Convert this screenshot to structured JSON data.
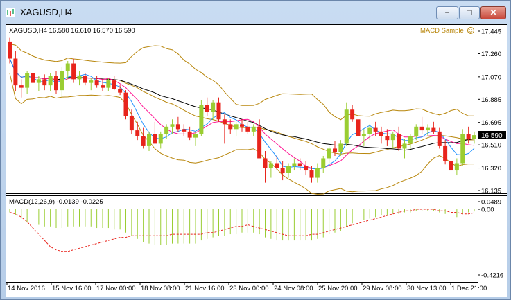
{
  "window": {
    "title": "XAGUSD,H4",
    "minimize_label": "−",
    "maximize_label": "□",
    "close_label": "✕",
    "icon": "chart-window-icon"
  },
  "chart_info": {
    "main_header": "XAGUSD,H4  16.580 16.610 16.570 16.590",
    "indicator_name": "MACD Sample",
    "indicator_icon": "smiley-face-icon",
    "macd_header": "MACD(12,26,9) -0.0139 -0.0225",
    "current_price_label": "16.590"
  },
  "colors": {
    "up_candle": "#9acd32",
    "down_candle": "#e8241c",
    "bollinger": "#b8860b",
    "ma_fast": "#1e90ff",
    "ma_mid": "#ff1493",
    "ma_slow": "#000000",
    "macd_hist": "#9acd32",
    "macd_signal": "#e8241c",
    "axis_text": "#000000",
    "price_tag": "#ffffff"
  },
  "chart_data": [
    {
      "type": "candlestick",
      "title": "XAGUSD,H4",
      "ylim": [
        16.135,
        17.445
      ],
      "y_ticks": [
        "17.445",
        "17.260",
        "17.070",
        "16.885",
        "16.695",
        "16.510",
        "16.320",
        "16.135"
      ],
      "x_ticks": [
        "14 Nov 2016",
        "15 Nov 16:00",
        "17 Nov 00:00",
        "18 Nov 08:00",
        "21 Nov 16:00",
        "23 Nov 00:00",
        "24 Nov 08:00",
        "25 Nov 20:00",
        "29 Nov 08:00",
        "30 Nov 13:00",
        "1 Dec 21:00"
      ],
      "last_price": 16.59,
      "candles": [
        [
          17.36,
          17.39,
          17.18,
          17.22
        ],
        [
          17.22,
          17.28,
          16.95,
          17.0
        ],
        [
          17.0,
          17.05,
          16.9,
          16.98
        ],
        [
          16.98,
          17.12,
          16.93,
          17.1
        ],
        [
          17.1,
          17.15,
          17.0,
          17.02
        ],
        [
          17.02,
          17.08,
          16.95,
          17.05
        ],
        [
          17.05,
          17.09,
          16.96,
          17.0
        ],
        [
          17.0,
          17.1,
          16.95,
          17.08
        ],
        [
          17.08,
          17.12,
          16.93,
          16.96
        ],
        [
          16.96,
          17.15,
          16.9,
          17.12
        ],
        [
          17.12,
          17.2,
          17.05,
          17.18
        ],
        [
          17.18,
          17.22,
          17.02,
          17.05
        ],
        [
          17.05,
          17.12,
          17.0,
          17.08
        ],
        [
          17.08,
          17.1,
          17.0,
          17.02
        ],
        [
          17.02,
          17.06,
          16.96,
          17.04
        ],
        [
          17.04,
          17.08,
          16.98,
          17.0
        ],
        [
          17.0,
          17.05,
          16.95,
          16.98
        ],
        [
          16.98,
          17.06,
          16.95,
          17.04
        ],
        [
          17.04,
          17.08,
          16.96,
          16.97
        ],
        [
          16.97,
          17.0,
          16.92,
          16.94
        ],
        [
          16.94,
          16.96,
          16.72,
          16.75
        ],
        [
          16.75,
          16.8,
          16.6,
          16.63
        ],
        [
          16.63,
          16.7,
          16.55,
          16.58
        ],
        [
          16.58,
          16.65,
          16.48,
          16.5
        ],
        [
          16.5,
          16.62,
          16.46,
          16.6
        ],
        [
          16.6,
          16.7,
          16.55,
          16.52
        ],
        [
          16.52,
          16.62,
          16.48,
          16.6
        ],
        [
          16.6,
          16.68,
          16.56,
          16.66
        ],
        [
          16.66,
          16.72,
          16.6,
          16.68
        ],
        [
          16.68,
          16.74,
          16.62,
          16.64
        ],
        [
          16.64,
          16.68,
          16.58,
          16.62
        ],
        [
          16.62,
          16.66,
          16.55,
          16.57
        ],
        [
          16.57,
          16.62,
          16.5,
          16.6
        ],
        [
          16.6,
          16.88,
          16.58,
          16.84
        ],
        [
          16.84,
          16.9,
          16.75,
          16.78
        ],
        [
          16.78,
          16.88,
          16.72,
          16.86
        ],
        [
          16.86,
          16.9,
          16.7,
          16.72
        ],
        [
          16.72,
          16.76,
          16.52,
          16.68
        ],
        [
          16.68,
          16.72,
          16.6,
          16.64
        ],
        [
          16.64,
          16.7,
          16.58,
          16.68
        ],
        [
          16.68,
          16.72,
          16.62,
          16.66
        ],
        [
          16.66,
          16.7,
          16.6,
          16.62
        ],
        [
          16.62,
          16.68,
          16.58,
          16.66
        ],
        [
          16.66,
          16.72,
          16.52,
          16.4
        ],
        [
          16.4,
          16.46,
          16.2,
          16.32
        ],
        [
          16.32,
          16.38,
          16.24,
          16.36
        ],
        [
          16.36,
          16.42,
          16.3,
          16.32
        ],
        [
          16.32,
          16.38,
          16.22,
          16.28
        ],
        [
          16.28,
          16.36,
          16.24,
          16.34
        ],
        [
          16.34,
          16.4,
          16.3,
          16.36
        ],
        [
          16.36,
          16.4,
          16.3,
          16.34
        ],
        [
          16.34,
          16.38,
          16.26,
          16.3
        ],
        [
          16.3,
          16.34,
          16.2,
          16.24
        ],
        [
          16.24,
          16.36,
          16.2,
          16.32
        ],
        [
          16.32,
          16.42,
          16.28,
          16.4
        ],
        [
          16.4,
          16.5,
          16.36,
          16.48
        ],
        [
          16.48,
          16.54,
          16.42,
          16.45
        ],
        [
          16.45,
          16.55,
          16.42,
          16.52
        ],
        [
          16.52,
          16.86,
          16.5,
          16.8
        ],
        [
          16.8,
          16.84,
          16.7,
          16.72
        ],
        [
          16.72,
          16.78,
          16.52,
          16.58
        ],
        [
          16.58,
          16.64,
          16.5,
          16.6
        ],
        [
          16.6,
          16.68,
          16.55,
          16.65
        ],
        [
          16.65,
          16.7,
          16.58,
          16.62
        ],
        [
          16.62,
          16.66,
          16.52,
          16.58
        ],
        [
          16.58,
          16.64,
          16.5,
          16.55
        ],
        [
          16.55,
          16.62,
          16.48,
          16.6
        ],
        [
          16.6,
          16.66,
          16.46,
          16.48
        ],
        [
          16.48,
          16.56,
          16.4,
          16.52
        ],
        [
          16.52,
          16.6,
          16.48,
          16.58
        ],
        [
          16.58,
          16.68,
          16.55,
          16.66
        ],
        [
          16.66,
          16.74,
          16.6,
          16.63
        ],
        [
          16.63,
          16.68,
          16.58,
          16.65
        ],
        [
          16.65,
          16.7,
          16.6,
          16.62
        ],
        [
          16.62,
          16.65,
          16.48,
          16.5
        ],
        [
          16.5,
          16.55,
          16.35,
          16.38
        ],
        [
          16.38,
          16.45,
          16.25,
          16.3
        ],
        [
          16.3,
          16.4,
          16.26,
          16.36
        ],
        [
          16.36,
          16.64,
          16.34,
          16.6
        ],
        [
          16.6,
          16.66,
          16.52,
          16.56
        ],
        [
          16.56,
          16.62,
          16.52,
          16.59
        ]
      ]
    },
    {
      "type": "histogram+line",
      "title": "MACD(12,26,9) -0.0139 -0.0225",
      "ylim": [
        -0.4216,
        0.0489
      ],
      "y_ticks": [
        "0.0489",
        "0.00",
        "-0.4216"
      ],
      "macd": [
        -0.02,
        -0.04,
        -0.06,
        -0.08,
        -0.09,
        -0.1,
        -0.11,
        -0.11,
        -0.12,
        -0.12,
        -0.11,
        -0.11,
        -0.11,
        -0.11,
        -0.11,
        -0.12,
        -0.12,
        -0.12,
        -0.13,
        -0.13,
        -0.15,
        -0.17,
        -0.19,
        -0.21,
        -0.22,
        -0.23,
        -0.23,
        -0.23,
        -0.22,
        -0.22,
        -0.22,
        -0.22,
        -0.22,
        -0.2,
        -0.19,
        -0.18,
        -0.17,
        -0.17,
        -0.16,
        -0.16,
        -0.15,
        -0.15,
        -0.15,
        -0.16,
        -0.18,
        -0.19,
        -0.2,
        -0.2,
        -0.2,
        -0.2,
        -0.2,
        -0.2,
        -0.2,
        -0.19,
        -0.18,
        -0.16,
        -0.15,
        -0.14,
        -0.11,
        -0.09,
        -0.08,
        -0.07,
        -0.06,
        -0.05,
        -0.04,
        -0.04,
        -0.03,
        -0.03,
        -0.02,
        -0.02,
        -0.01,
        -0.01,
        -0.01,
        -0.01,
        -0.02,
        -0.03,
        -0.04,
        -0.05,
        -0.03,
        -0.02,
        -0.014
      ],
      "signal": [
        -0.02,
        -0.03,
        -0.05,
        -0.08,
        -0.12,
        -0.16,
        -0.2,
        -0.24,
        -0.26,
        -0.27,
        -0.27,
        -0.26,
        -0.25,
        -0.24,
        -0.23,
        -0.22,
        -0.21,
        -0.2,
        -0.19,
        -0.18,
        -0.18,
        -0.17,
        -0.17,
        -0.17,
        -0.17,
        -0.17,
        -0.17,
        -0.17,
        -0.16,
        -0.16,
        -0.16,
        -0.16,
        -0.16,
        -0.16,
        -0.15,
        -0.15,
        -0.14,
        -0.13,
        -0.12,
        -0.11,
        -0.11,
        -0.1,
        -0.11,
        -0.12,
        -0.13,
        -0.14,
        -0.15,
        -0.16,
        -0.17,
        -0.17,
        -0.17,
        -0.17,
        -0.16,
        -0.16,
        -0.15,
        -0.14,
        -0.13,
        -0.12,
        -0.11,
        -0.1,
        -0.09,
        -0.08,
        -0.07,
        -0.06,
        -0.05,
        -0.04,
        -0.03,
        -0.02,
        -0.01,
        -0.01,
        0.0,
        0.0,
        0.0,
        0.0,
        -0.01,
        -0.01,
        -0.02,
        -0.02,
        -0.03,
        -0.03,
        -0.0225
      ]
    }
  ]
}
